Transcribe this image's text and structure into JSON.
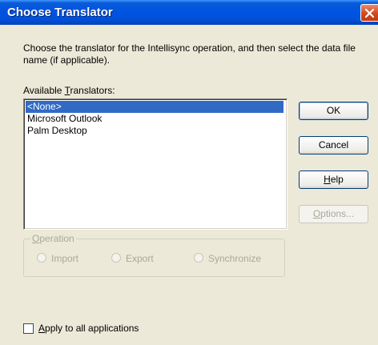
{
  "window": {
    "title": "Choose Translator"
  },
  "instructions": "Choose the translator for the Intellisync operation, and then select the data file name (if applicable).",
  "available_label": {
    "before": "Available ",
    "mnemonic": "T",
    "after": "ranslators:"
  },
  "translators": {
    "items": [
      "<None>",
      "Microsoft Outlook",
      "Palm Desktop"
    ],
    "selected_index": 0
  },
  "buttons": {
    "ok": "OK",
    "cancel": "Cancel",
    "help": {
      "mnemonic": "H",
      "rest": "elp"
    },
    "options": {
      "mnemonic": "O",
      "rest": "ptions..."
    }
  },
  "operation": {
    "legend_mnemonic": "O",
    "legend_rest": "peration",
    "import": "Import",
    "export": "Export",
    "synchronize": "Synchronize"
  },
  "apply_all": {
    "mnemonic": "A",
    "rest": "pply to all applications",
    "checked": false
  },
  "colors": {
    "title_bar": "#0054e3",
    "selection": "#316ac5",
    "disabled_text": "#aca899",
    "dialog_bg": "#ece9d8"
  }
}
